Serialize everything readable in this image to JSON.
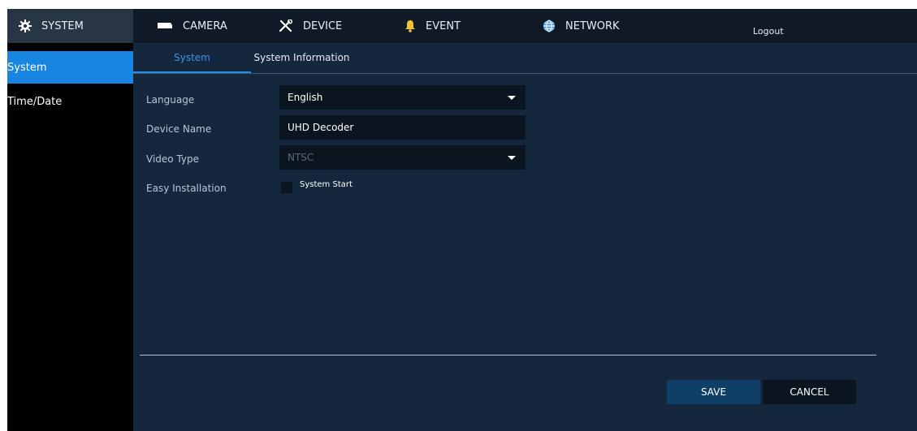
{
  "topbar": {
    "system": "SYSTEM",
    "camera": "CAMERA",
    "device": "DEVICE",
    "event": "EVENT",
    "network": "NETWORK",
    "logout": "Logout"
  },
  "sidebar": {
    "items": [
      {
        "label": "System",
        "active": true
      },
      {
        "label": "Time/Date",
        "active": false
      }
    ]
  },
  "tabs": [
    {
      "label": "System",
      "active": true
    },
    {
      "label": "System Information",
      "active": false
    }
  ],
  "form": {
    "language": {
      "label": "Language",
      "value": "English"
    },
    "device_name": {
      "label": "Device Name",
      "value": "UHD Decoder"
    },
    "video_type": {
      "label": "Video Type",
      "value": "NTSC"
    },
    "easy_installation": {
      "label": "Easy Installation",
      "checkbox_label": "System Start",
      "checked": false
    }
  },
  "buttons": {
    "save": "SAVE",
    "cancel": "CANCEL"
  },
  "colors": {
    "accent": "#1886e0",
    "background": "#15273d",
    "topbar": "#101a26"
  }
}
